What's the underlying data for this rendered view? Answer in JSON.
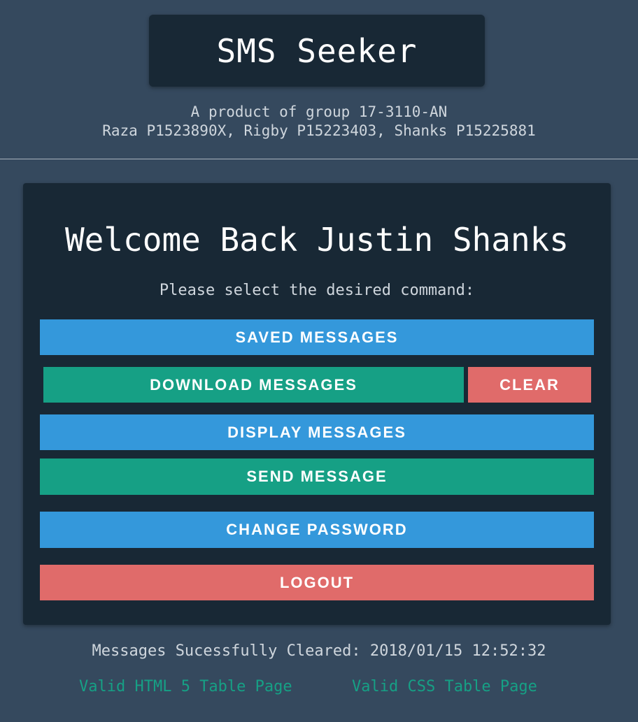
{
  "header": {
    "title": "SMS Seeker",
    "credits_line1": "A product of group 17-3110-AN",
    "credits_line2": "Raza P1523890X, Rigby P15223403, Shanks P15225881"
  },
  "panel": {
    "welcome": "Welcome Back Justin Shanks",
    "prompt": "Please select the desired command:",
    "buttons": {
      "saved_messages": "SAVED MESSAGES",
      "download_messages": "DOWNLOAD MESSAGES",
      "clear": "CLEAR",
      "display_messages": "DISPLAY MESSAGES",
      "send_message": "SEND MESSAGE",
      "change_password": "CHANGE PASSWORD",
      "logout": "LOGOUT"
    }
  },
  "status": {
    "message": "Messages Sucessfully Cleared: 2018/01/15 12:52:32"
  },
  "footer": {
    "html_link": "Valid HTML 5 Table Page",
    "css_link": "Valid CSS Table Page"
  },
  "colors": {
    "background": "#35495e",
    "panel": "#182835",
    "blue": "#3498db",
    "green": "#16a085",
    "red": "#e06b6a"
  }
}
